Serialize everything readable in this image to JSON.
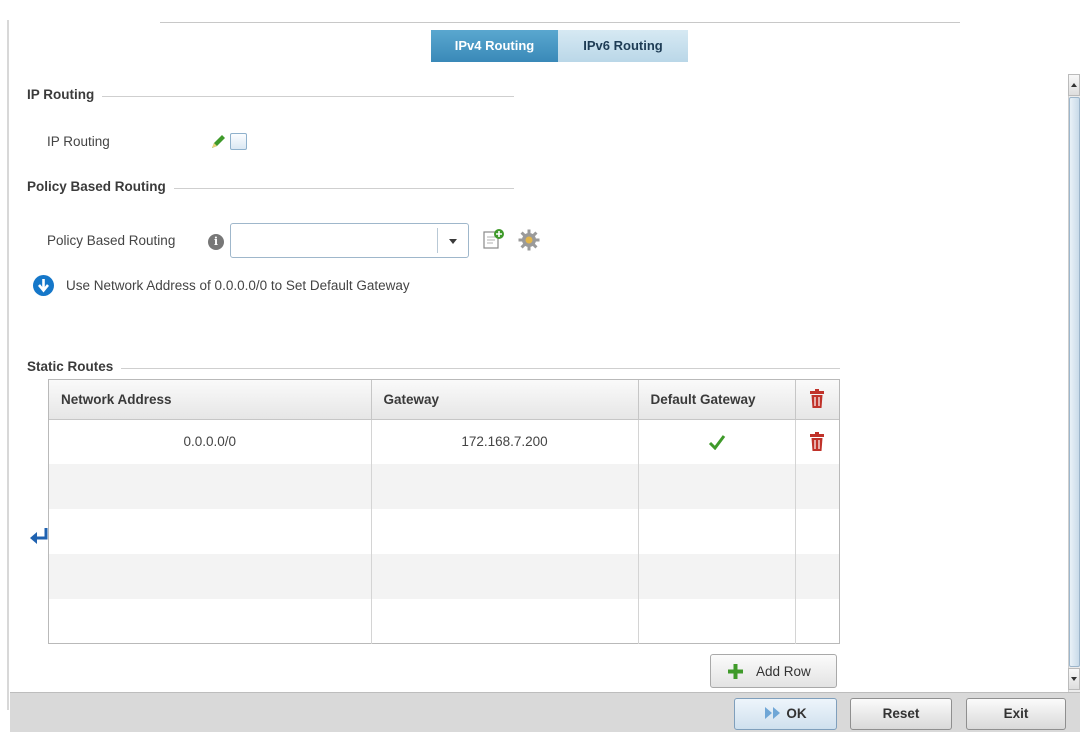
{
  "tabs": [
    {
      "label": "IPv4 Routing",
      "active": true
    },
    {
      "label": "IPv6 Routing",
      "active": false
    }
  ],
  "ip_routing": {
    "section_title": "IP Routing",
    "field_label": "IP Routing",
    "checked": false
  },
  "pbr": {
    "section_title": "Policy Based Routing",
    "field_label": "Policy Based Routing",
    "selected_value": ""
  },
  "hint": {
    "text": "Use Network Address of 0.0.0.0/0 to Set Default Gateway"
  },
  "static_routes": {
    "section_title": "Static Routes",
    "columns": [
      "Network Address",
      "Gateway",
      "Default Gateway"
    ],
    "rows": [
      {
        "network_address": "0.0.0.0/0",
        "gateway": "172.168.7.200",
        "default_gateway": true
      }
    ],
    "add_row_label": "Add Row"
  },
  "footer": {
    "ok_label": "OK",
    "reset_label": "Reset",
    "exit_label": "Exit"
  },
  "colors": {
    "tab_active": "#3a89b8",
    "tab_inactive": "#bad7e8",
    "trash_red": "#c0322a",
    "check_green": "#3f9a2a",
    "hint_blue": "#1577c9"
  }
}
